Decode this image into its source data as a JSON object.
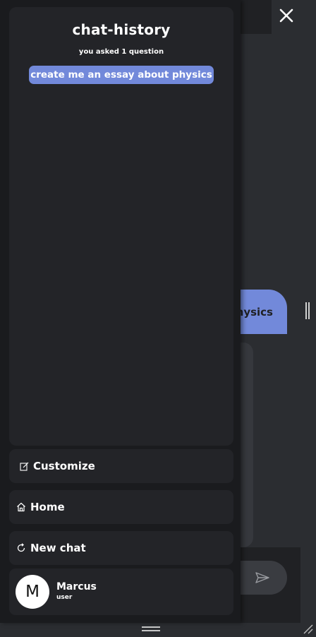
{
  "history": {
    "title": "chat-history",
    "subtitle": "you asked 1 question",
    "items": [
      {
        "label": "create me an essay about physics"
      }
    ]
  },
  "menu": {
    "customize": {
      "label": "Customize",
      "icon": "edit-icon"
    },
    "home": {
      "label": "Home",
      "icon": "home-icon"
    },
    "new_chat": {
      "label": "New chat",
      "icon": "refresh-icon"
    }
  },
  "profile": {
    "initial": "M",
    "name": "Marcus",
    "role": "user"
  },
  "chat": {
    "user_message_visible": "hysics"
  },
  "colors": {
    "accent": "#7289da",
    "drawer_bg": "#1a1b1e",
    "panel_bg": "#232428",
    "app_bg": "#2b2d31"
  }
}
